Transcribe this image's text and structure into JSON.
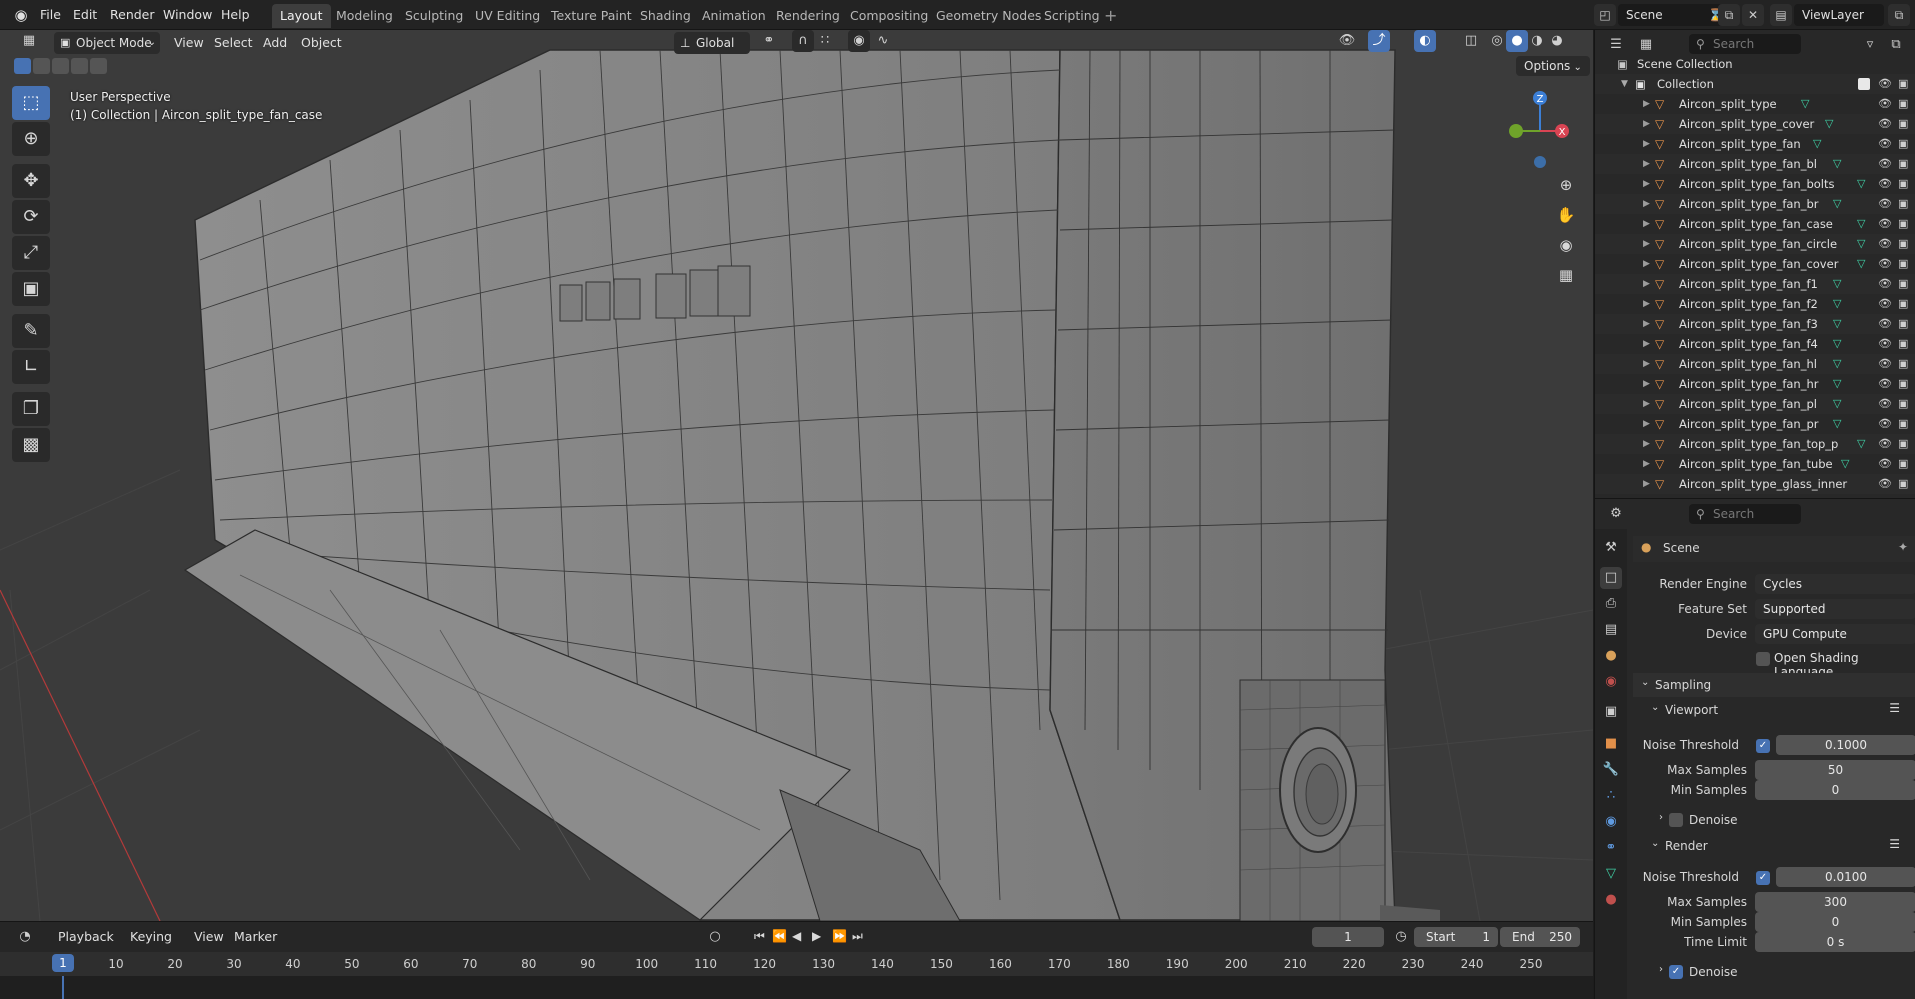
{
  "app": {
    "menus": [
      "File",
      "Edit",
      "Render",
      "Window",
      "Help"
    ],
    "workspaces": [
      "Layout",
      "Modeling",
      "Sculpting",
      "UV Editing",
      "Texture Paint",
      "Shading",
      "Animation",
      "Rendering",
      "Compositing",
      "Geometry Nodes",
      "Scripting"
    ],
    "active_workspace": "Layout",
    "scene_name": "Scene",
    "view_layer": "ViewLayer"
  },
  "viewport": {
    "mode": "Object Mode",
    "menus": [
      "View",
      "Select",
      "Add",
      "Object"
    ],
    "transform_orientation": "Global",
    "options_label": "Options",
    "perspective_label": "User Perspective",
    "collection_label": "(1) Collection | Aircon_split_type_fan_case",
    "gizmo": {
      "z": "Z",
      "x": "X"
    },
    "colors": {
      "background": "#3b3b3b",
      "mesh": "#8a8a8a",
      "wire": "#2a2a2a",
      "active_blue": "#4772b3"
    }
  },
  "timeline": {
    "menus": [
      "Playback",
      "Keying",
      "View",
      "Marker"
    ],
    "current_frame": "1",
    "start_label": "Start",
    "start_value": "1",
    "end_label": "End",
    "end_value": "250",
    "ticks": [
      "1",
      "10",
      "20",
      "30",
      "40",
      "50",
      "60",
      "70",
      "80",
      "90",
      "100",
      "110",
      "120",
      "130",
      "140",
      "150",
      "160",
      "170",
      "180",
      "190",
      "200",
      "210",
      "220",
      "230",
      "240",
      "250"
    ]
  },
  "outliner": {
    "search_placeholder": "Search",
    "scene_collection": "Scene Collection",
    "collection": "Collection",
    "items": [
      "Aircon_split_type",
      "Aircon_split_type_cover",
      "Aircon_split_type_fan",
      "Aircon_split_type_fan_bl",
      "Aircon_split_type_fan_bolts",
      "Aircon_split_type_fan_br",
      "Aircon_split_type_fan_case",
      "Aircon_split_type_fan_circle",
      "Aircon_split_type_fan_cover",
      "Aircon_split_type_fan_f1",
      "Aircon_split_type_fan_f2",
      "Aircon_split_type_fan_f3",
      "Aircon_split_type_fan_f4",
      "Aircon_split_type_fan_hl",
      "Aircon_split_type_fan_hr",
      "Aircon_split_type_fan_pl",
      "Aircon_split_type_fan_pr",
      "Aircon_split_type_fan_top_p",
      "Aircon_split_type_fan_tube",
      "Aircon_split_type_glass_inner"
    ]
  },
  "properties": {
    "search_placeholder": "Search",
    "context": "Scene",
    "render_engine_label": "Render Engine",
    "render_engine": "Cycles",
    "feature_set_label": "Feature Set",
    "feature_set": "Supported",
    "device_label": "Device",
    "device": "GPU Compute",
    "osl_label": "Open Shading Language",
    "sampling_label": "Sampling",
    "viewport_label": "Viewport",
    "render_label": "Render",
    "noise_threshold_label": "Noise Threshold",
    "max_samples_label": "Max Samples",
    "min_samples_label": "Min Samples",
    "time_limit_label": "Time Limit",
    "denoise_label": "Denoise",
    "viewport_noise_threshold": "0.1000",
    "viewport_max_samples": "50",
    "viewport_min_samples": "0",
    "render_noise_threshold": "0.0100",
    "render_max_samples": "300",
    "render_min_samples": "0",
    "render_time_limit": "0 s"
  }
}
